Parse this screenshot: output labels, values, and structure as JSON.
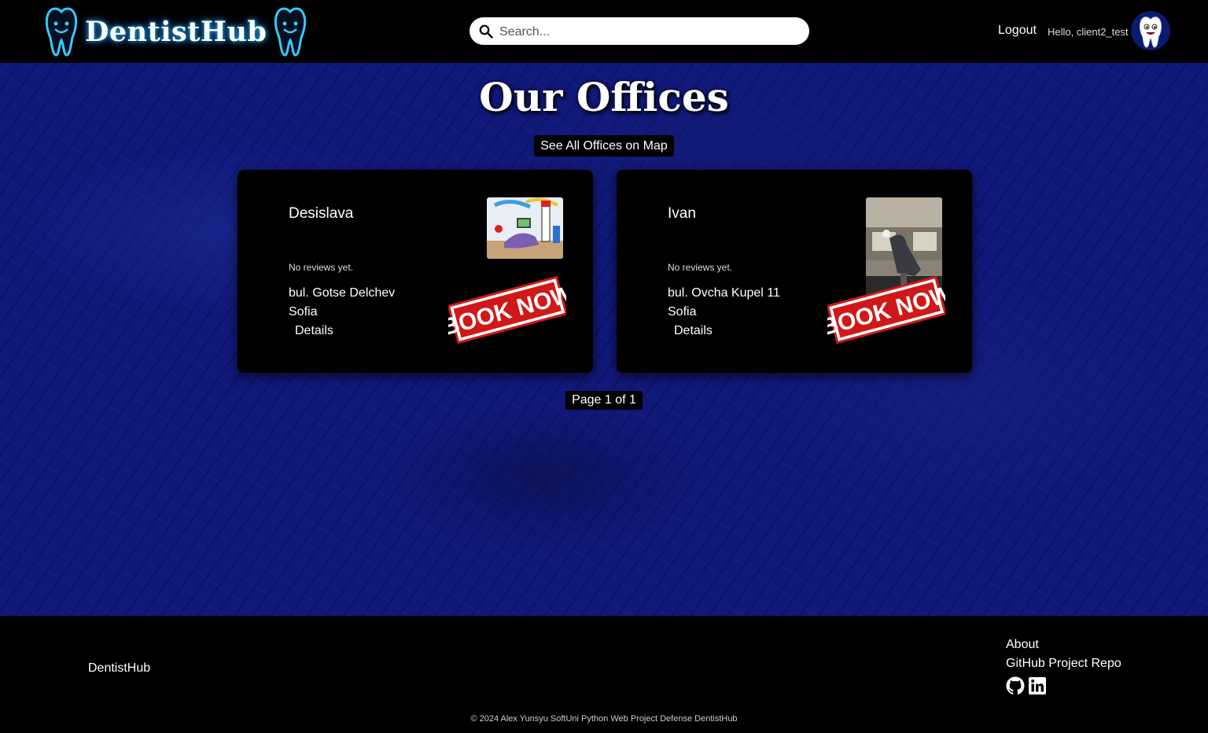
{
  "header": {
    "brand": "DentistHub",
    "search_placeholder": "Search...",
    "logout_label": "Logout",
    "greeting": "Hello, client2_test"
  },
  "main": {
    "title": "Our Offices",
    "map_button_label": "See All Offices on Map",
    "offices": [
      {
        "name": "Desislava",
        "reviews": "No reviews yet.",
        "street": "bul. Gotse Delchev",
        "city": "Sofia",
        "details_label": "Details",
        "book_label": "BOOK NOW"
      },
      {
        "name": "Ivan",
        "reviews": "No reviews yet.",
        "street": "bul. Ovcha Kupel 11",
        "city": "Sofia",
        "details_label": "Details",
        "book_label": "BOOK NOW"
      }
    ],
    "pagination": "Page 1 of 1"
  },
  "footer": {
    "brand": "DentistHub",
    "about_label": "About",
    "repo_label": "GitHub Project Repo",
    "copyright": "© 2024 Alex Yunsyu SoftUni Python Web Project Defense DentistHub"
  },
  "icons": [
    "tooth-icon",
    "search-icon",
    "avatar-tooth-icon",
    "book-now-stamp-icon",
    "github-icon",
    "linkedin-icon"
  ],
  "colors": {
    "header_bg": "#000000",
    "main_bg": "#10187a",
    "card_bg": "#000000",
    "neon_blue": "#29b6ff",
    "stamp_red": "#d01818"
  }
}
